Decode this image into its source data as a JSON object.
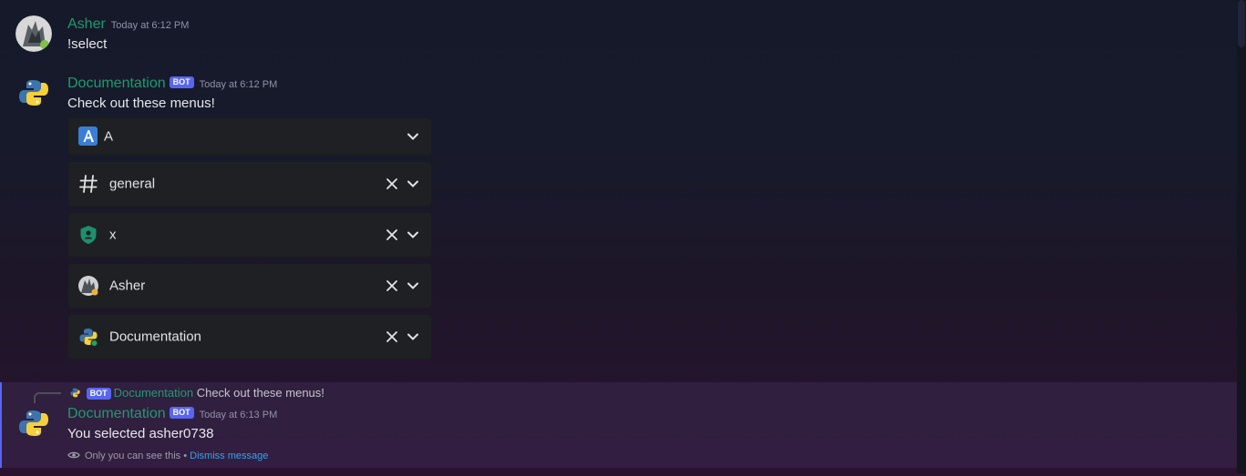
{
  "messages": [
    {
      "author": "Asher",
      "timestamp": "Today at 6:12 PM",
      "content": "!select",
      "avatar_icon": "asher-avatar"
    },
    {
      "author": "Documentation",
      "bot_tag": "BOT",
      "timestamp": "Today at 6:12 PM",
      "content": "Check out these menus!",
      "avatar_icon": "python-logo-icon",
      "selects": [
        {
          "label": "A",
          "icon": "role-letter-a-icon",
          "clearable": false
        },
        {
          "label": "general",
          "icon": "channel-hash-icon",
          "clearable": true
        },
        {
          "label": "x",
          "icon": "role-shield-icon",
          "clearable": true
        },
        {
          "label": "Asher",
          "icon": "user-avatar-icon",
          "clearable": true
        },
        {
          "label": "Documentation",
          "icon": "python-logo-icon",
          "clearable": true
        }
      ]
    }
  ],
  "ephemeral": {
    "reply": {
      "bot_tag": "BOT",
      "author": "Documentation",
      "content": "Check out these menus!"
    },
    "author": "Documentation",
    "bot_tag": "BOT",
    "timestamp": "Today at 6:13 PM",
    "content": "You selected asher0738",
    "notice": "Only you can see this",
    "separator": "•",
    "dismiss_label": "Dismiss message"
  },
  "colors": {
    "author_green": "#1f9b6e",
    "bot_tag": "#5865f2",
    "link_blue": "#36a2f0",
    "select_bg": "#1f2023"
  }
}
